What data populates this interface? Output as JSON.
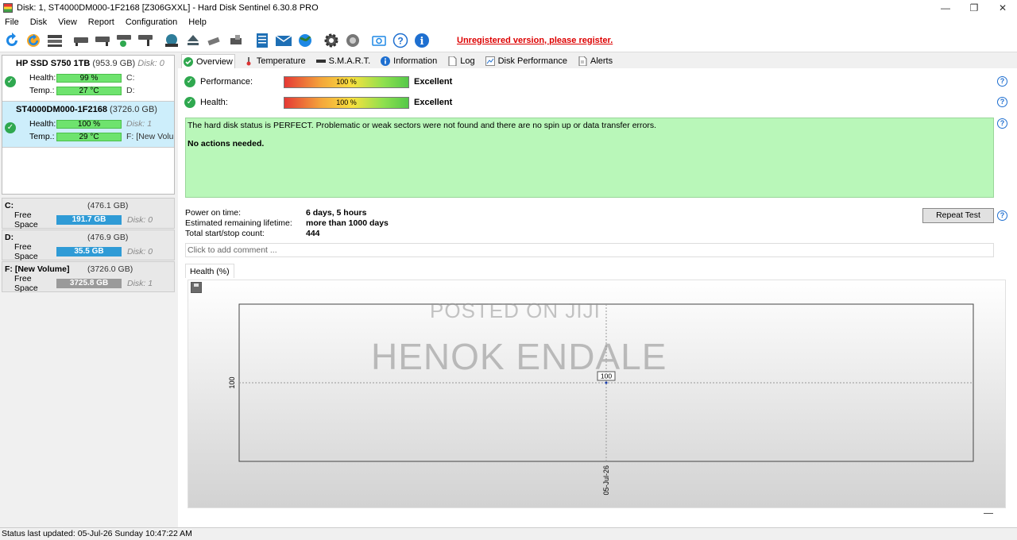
{
  "window": {
    "title": "Disk: 1, ST4000DM000-1F2168 [Z306GXXL]  -  Hard Disk Sentinel 6.30.8 PRO",
    "controls": {
      "minimize": "—",
      "maximize": "❐",
      "close": "✕"
    }
  },
  "menu": [
    "File",
    "Disk",
    "View",
    "Report",
    "Configuration",
    "Help"
  ],
  "toolbar": {
    "unregistered": "Unregistered version, please register.",
    "icons": [
      "refresh-icon",
      "refresh-all-icon",
      "disk-list-icon",
      "disk-test-icon",
      "surface-test-icon",
      "disk-ok-icon",
      "disk-repair-icon",
      "globe-disk-icon",
      "eject-icon",
      "tools-icon",
      "printer-icon",
      "report-icon",
      "mail-icon",
      "web-icon",
      "settings-icon",
      "options-icon",
      "camera-icon",
      "help-icon",
      "info-icon"
    ]
  },
  "disks": [
    {
      "name": "HP SSD S750 1TB",
      "size": "(953.9 GB)",
      "disk": "Disk: 0",
      "health_label": "Health:",
      "health": "99 %",
      "temp_label": "Temp.:",
      "temp": "27 °C",
      "drive1": "C:",
      "drive2": "D:"
    },
    {
      "name": "ST4000DM000-1F2168",
      "size": "(3726.0 GB)",
      "disk": "",
      "health_label": "Health:",
      "health": "100 %",
      "temp_label": "Temp.:",
      "temp": "29 °C",
      "drive1": "Disk: 1",
      "drive2": "F: [New Volume]"
    }
  ],
  "volumes": [
    {
      "name": "C:",
      "size": "(476.1 GB)",
      "free_label": "Free Space",
      "free": "191.7 GB",
      "disk": "Disk: 0"
    },
    {
      "name": "D:",
      "size": "(476.9 GB)",
      "free_label": "Free Space",
      "free": "35.5 GB",
      "disk": "Disk: 0"
    },
    {
      "name": "F: [New Volume]",
      "size": "(3726.0 GB)",
      "free_label": "Free Space",
      "free": "3725.8 GB",
      "disk": "Disk: 1"
    }
  ],
  "tabs": [
    "Overview",
    "Temperature",
    "S.M.A.R.T.",
    "Information",
    "Log",
    "Disk Performance",
    "Alerts"
  ],
  "overview": {
    "performance_label": "Performance:",
    "performance_value": "100 %",
    "performance_rating": "Excellent",
    "health_label": "Health:",
    "health_value": "100 %",
    "health_rating": "Excellent",
    "status_text": "The hard disk status is PERFECT. Problematic or weak sectors were not found and there are no spin up or data transfer errors.",
    "action_text": "No actions needed.",
    "power_on_label": "Power on time:",
    "power_on_value": "6 days, 5 hours",
    "lifetime_label": "Estimated remaining lifetime:",
    "lifetime_value": "more than 1000 days",
    "startstop_label": "Total start/stop count:",
    "startstop_value": "444",
    "repeat_button": "Repeat Test",
    "comment_placeholder": "Click to add comment ...",
    "health_tab": "Health (%)",
    "help": "?"
  },
  "watermark": {
    "line1": "POSTED ON JIJI",
    "line2": "HENOK ENDALE"
  },
  "chart_data": {
    "type": "line",
    "x": [
      "05-Jul-26"
    ],
    "series": [
      {
        "values": [
          100
        ]
      }
    ],
    "y_tick": "100",
    "point_label": "100",
    "ylim": [
      0,
      200
    ]
  },
  "statusbar": "Status last updated: 05-Jul-26 Sunday 10:47:22 AM",
  "colors": {
    "health_green": "#6ee36e",
    "status_green": "#b9f7b9",
    "volume_blue": "#2f9bd6",
    "warning_red": "#dd0000"
  }
}
